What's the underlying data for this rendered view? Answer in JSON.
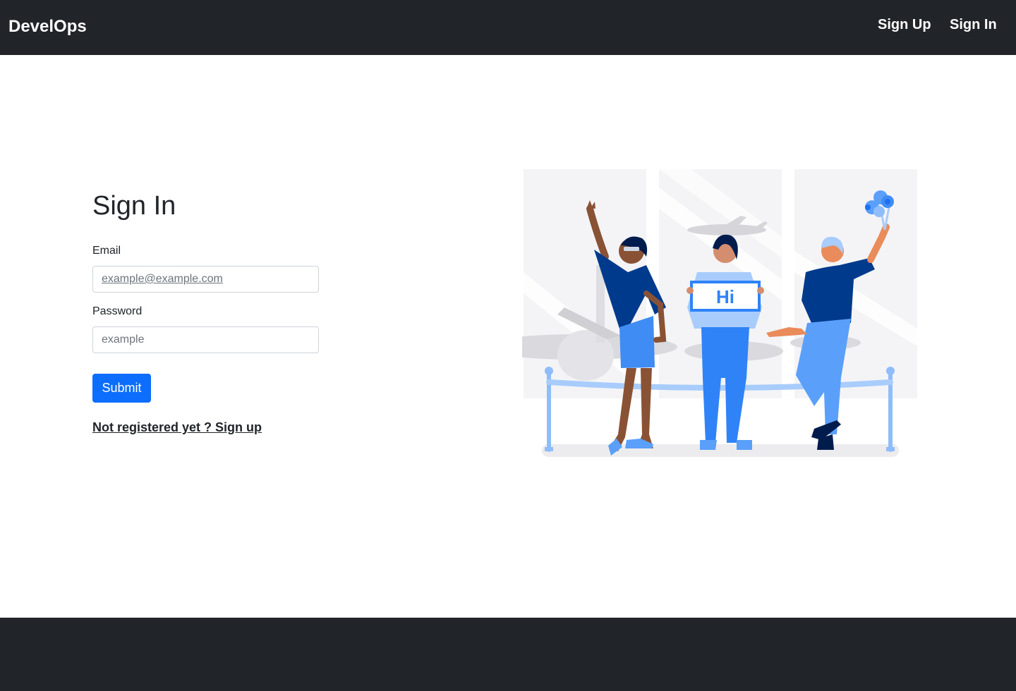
{
  "navbar": {
    "brand": "DevelOps",
    "links": [
      {
        "label": "Sign Up"
      },
      {
        "label": "Sign In"
      }
    ],
    "background_color": "#212529"
  },
  "form": {
    "title": "Sign In",
    "email_label": "Email",
    "email_placeholder": "example@example.com",
    "password_label": "Password",
    "password_placeholder": "example",
    "submit_label": "Submit",
    "register_link": "Not registered yet ? Sign up",
    "accent_color": "#0d6efd"
  },
  "illustration": {
    "sign_text": "Hi"
  },
  "footer": {
    "background_color": "#212529"
  }
}
